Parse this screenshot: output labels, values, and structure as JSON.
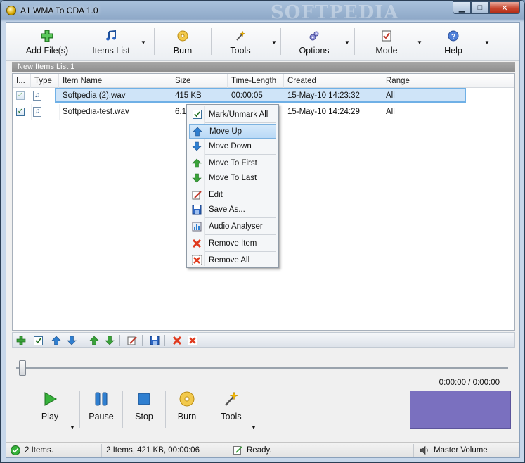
{
  "window": {
    "title": "A1 WMA To CDA 1.0",
    "watermark": "SOFTPEDIA",
    "controls": {
      "minimize": "▁",
      "maximize": "□",
      "close": "✕"
    }
  },
  "toolbar": {
    "items": [
      {
        "label": "Add File(s)",
        "icon": "add-icon"
      },
      {
        "label": "Items List",
        "icon": "music-note-icon"
      },
      {
        "label": "Burn",
        "icon": "disc-icon"
      },
      {
        "label": "Tools",
        "icon": "wand-icon"
      },
      {
        "label": "Options",
        "icon": "gears-icon"
      },
      {
        "label": "Mode",
        "icon": "mode-icon"
      },
      {
        "label": "Help",
        "icon": "help-icon"
      }
    ]
  },
  "list": {
    "header_title": "New Items List 1",
    "columns": [
      "I...",
      "Type",
      "Item Name",
      "Size",
      "Time-Length",
      "Created",
      "Range"
    ],
    "rows": [
      {
        "name": "Softpedia (2).wav",
        "size": "415 KB",
        "length": "00:00:05",
        "created": "15-May-10 14:23:32",
        "range": "All",
        "checked": true,
        "selected": true
      },
      {
        "name": "Softpedia-test.wav",
        "size": "6.1",
        "length": "",
        "created": "15-May-10 14:24:29",
        "range": "All",
        "checked": true,
        "selected": false
      }
    ]
  },
  "context_menu": {
    "items": [
      {
        "label": "Mark/Unmark All",
        "icon": "checkbox-icon"
      },
      {
        "label": "Move Up",
        "icon": "arrow-up-blue-icon"
      },
      {
        "label": "Move Down",
        "icon": "arrow-down-blue-icon"
      },
      {
        "label": "Move To First",
        "icon": "arrow-up-green-icon"
      },
      {
        "label": "Move To Last",
        "icon": "arrow-down-green-icon"
      },
      {
        "label": "Edit",
        "icon": "edit-icon"
      },
      {
        "label": "Save As...",
        "icon": "save-icon"
      },
      {
        "label": "Audio Analyser",
        "icon": "analyser-icon"
      },
      {
        "label": "Remove Item",
        "icon": "remove-icon"
      },
      {
        "label": "Remove All",
        "icon": "remove-all-icon"
      }
    ],
    "highlighted": "Move Up"
  },
  "player": {
    "time": "0:00:00 / 0:00:00",
    "seek_progress": 0,
    "buttons": [
      {
        "label": "Play",
        "icon": "play-icon"
      },
      {
        "label": "Pause",
        "icon": "pause-icon"
      },
      {
        "label": "Stop",
        "icon": "stop-icon"
      },
      {
        "label": "Burn",
        "icon": "disc-icon"
      },
      {
        "label": "Tools",
        "icon": "wand-icon"
      }
    ]
  },
  "statusbar": {
    "items_count": "2 Items.",
    "summary": "2 Items, 421 KB, 00:00:06",
    "state": "Ready.",
    "volume": "Master Volume"
  },
  "colors": {
    "selection": "#cfe4f8",
    "visualizer": "#7a70bf",
    "accent_green": "#3aa23a",
    "accent_blue": "#2f7fd0"
  }
}
